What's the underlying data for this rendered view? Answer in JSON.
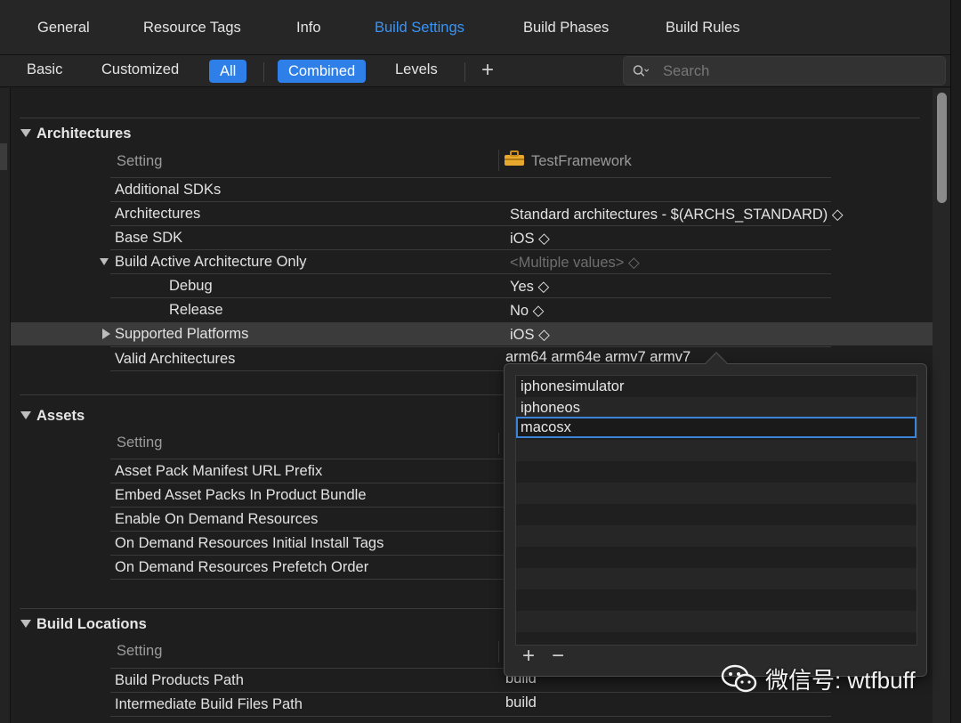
{
  "tabs": {
    "general": "General",
    "resource_tags": "Resource Tags",
    "info": "Info",
    "build_settings": "Build Settings",
    "build_phases": "Build Phases",
    "build_rules": "Build Rules"
  },
  "filters": {
    "basic": "Basic",
    "customized": "Customized",
    "all": "All",
    "combined": "Combined",
    "levels": "Levels",
    "add": "+"
  },
  "search": {
    "placeholder": "Search"
  },
  "column_header": {
    "setting": "Setting",
    "target": "TestFramework"
  },
  "architectures": {
    "title": "Architectures",
    "rows": [
      {
        "label": "Additional SDKs",
        "value": ""
      },
      {
        "label": "Architectures",
        "value": "Standard architectures  -  $(ARCHS_STANDARD) ◇"
      },
      {
        "label": "Base SDK",
        "value": "iOS ◇"
      },
      {
        "label": "Build Active Architecture Only",
        "value": "<Multiple values> ◇"
      },
      {
        "label": "Debug",
        "value": "Yes ◇"
      },
      {
        "label": "Release",
        "value": "No ◇"
      },
      {
        "label": "Supported Platforms",
        "value": "iOS ◇"
      },
      {
        "label": "Valid Architectures",
        "value": "arm64 arm64e armv7 armv7"
      }
    ]
  },
  "assets": {
    "title": "Assets",
    "rows": [
      {
        "label": "Asset Pack Manifest URL Prefix"
      },
      {
        "label": "Embed Asset Packs In Product Bundle"
      },
      {
        "label": "Enable On Demand Resources"
      },
      {
        "label": "On Demand Resources Initial Install Tags"
      },
      {
        "label": "On Demand Resources Prefetch Order"
      }
    ]
  },
  "build_locations": {
    "title": "Build Locations",
    "rows": [
      {
        "label": "Build Products Path",
        "value": "build"
      },
      {
        "label": "Intermediate Build Files Path",
        "value": "build"
      }
    ]
  },
  "popover": {
    "items": [
      "iphonesimulator",
      "iphoneos",
      "macosx"
    ],
    "add": "+",
    "remove": "−"
  },
  "watermark": {
    "text": "微信号: wtfbuff"
  },
  "colors": {
    "accent": "#3a94f5",
    "pill": "#2f7fe8",
    "background": "#1e1e1e"
  }
}
